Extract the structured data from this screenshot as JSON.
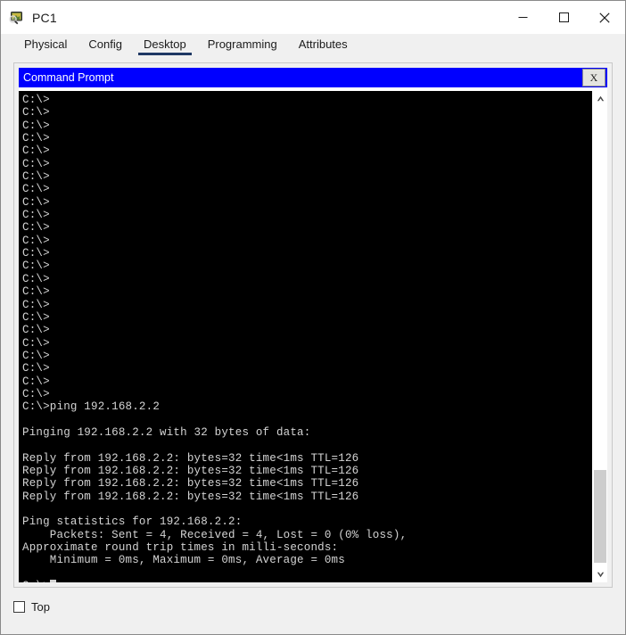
{
  "window": {
    "title": "PC1",
    "icon": "packet-tracer-pc-icon",
    "controls": {
      "minimize": "—",
      "maximize": "□",
      "close": "✕"
    }
  },
  "tabs": [
    {
      "label": "Physical",
      "active": false
    },
    {
      "label": "Config",
      "active": false
    },
    {
      "label": "Desktop",
      "active": true
    },
    {
      "label": "Programming",
      "active": false
    },
    {
      "label": "Attributes",
      "active": false
    }
  ],
  "command_prompt": {
    "caption": "Command Prompt",
    "close_label": "X",
    "console_text": "C:\\>\nC:\\>\nC:\\>\nC:\\>\nC:\\>\nC:\\>\nC:\\>\nC:\\>\nC:\\>\nC:\\>\nC:\\>\nC:\\>\nC:\\>\nC:\\>\nC:\\>\nC:\\>\nC:\\>\nC:\\>\nC:\\>\nC:\\>\nC:\\>\nC:\\>\nC:\\>\nC:\\>\nC:\\>ping 192.168.2.2\n\nPinging 192.168.2.2 with 32 bytes of data:\n\nReply from 192.168.2.2: bytes=32 time<1ms TTL=126\nReply from 192.168.2.2: bytes=32 time<1ms TTL=126\nReply from 192.168.2.2: bytes=32 time<1ms TTL=126\nReply from 192.168.2.2: bytes=32 time<1ms TTL=126\n\nPing statistics for 192.168.2.2:\n    Packets: Sent = 4, Received = 4, Lost = 0 (0% loss),\nApproximate round trip times in milli-seconds:\n    Minimum = 0ms, Maximum = 0ms, Average = 0ms\n\nC:\\>",
    "command": "ping 192.168.2.2",
    "target_host": "192.168.2.2",
    "packet_bytes": "32",
    "replies": [
      "Reply from 192.168.2.2: bytes=32 time<1ms TTL=126",
      "Reply from 192.168.2.2: bytes=32 time<1ms TTL=126",
      "Reply from 192.168.2.2: bytes=32 time<1ms TTL=126",
      "Reply from 192.168.2.2: bytes=32 time<1ms TTL=126"
    ],
    "statistics": {
      "sent": "4",
      "received": "4",
      "lost": "0",
      "loss_percent": "0%",
      "minimum": "0ms",
      "maximum": "0ms",
      "average": "0ms"
    },
    "scrollbar": {
      "up_arrow": "▲",
      "down_arrow": "▼",
      "thumb_top_pct": "79",
      "thumb_height_pct": "20"
    }
  },
  "bottom": {
    "top_checkbox_label": "Top",
    "top_checkbox_checked": false
  },
  "colors": {
    "caption_blue": "#0000ff",
    "console_bg": "#000000",
    "console_fg": "#d4d4d4",
    "active_tab_underline": "#1f3864",
    "window_bg": "#f0f0f0"
  }
}
